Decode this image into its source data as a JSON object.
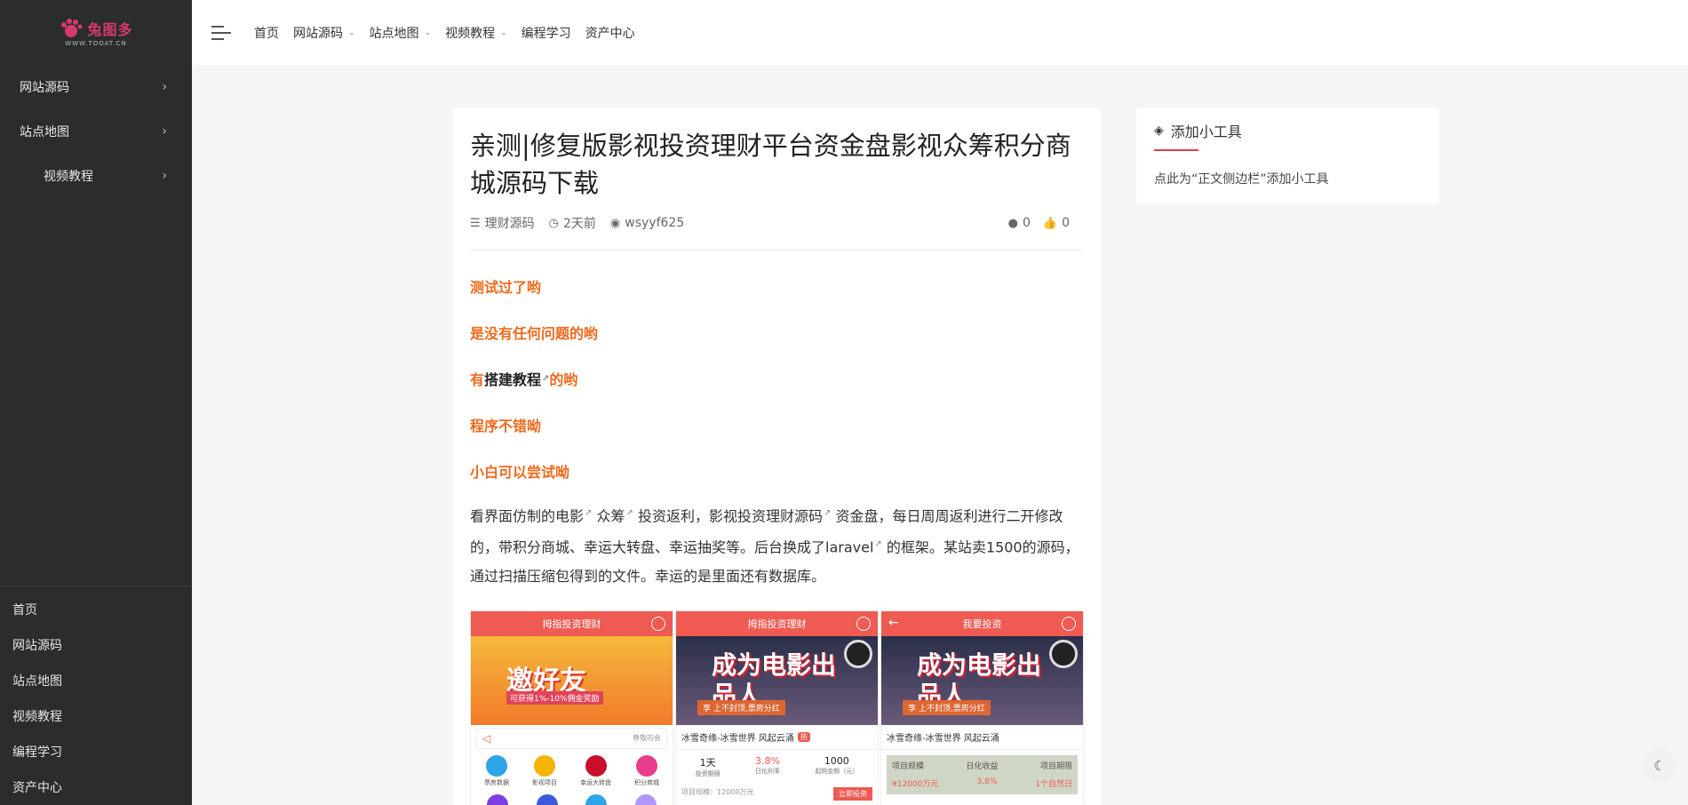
{
  "logo": {
    "text": "兔图多",
    "sub": "WWW.TOOAT.CN"
  },
  "sidebar": {
    "items": [
      {
        "label": "网站源码",
        "indent": false
      },
      {
        "label": "站点地图",
        "indent": false
      },
      {
        "label": "视频教程",
        "indent": true
      }
    ],
    "chevron": "›",
    "bottom_links": [
      "首页",
      "网站源码",
      "站点地图",
      "视频教程",
      "编程学习",
      "资产中心"
    ]
  },
  "topnav": {
    "items": [
      {
        "label": "首页",
        "dropdown": false
      },
      {
        "label": "网站源码",
        "dropdown": true
      },
      {
        "label": "站点地图",
        "dropdown": true
      },
      {
        "label": "视频教程",
        "dropdown": true
      },
      {
        "label": "编程学习",
        "dropdown": false
      },
      {
        "label": "资产中心",
        "dropdown": false
      }
    ],
    "caret": "⌄"
  },
  "post": {
    "title": "亲测|修复版影视投资理财平台资金盘影视众筹积分商城源码下载",
    "meta": {
      "category": "理财源码",
      "time": "2天前",
      "author": "wsyyf625",
      "comments": "0",
      "likes": "0"
    },
    "lines": {
      "l1": "测试过了哟",
      "l2": "是没有任何问题的哟",
      "l3_pre": "有",
      "l3_link": "搭建教程",
      "l3_post": " 的哟",
      "l4": "程序不错呦",
      "l5": "小白可以尝试呦"
    },
    "paragraph": {
      "p1": "看界面仿制的电影",
      "p2": " 众筹",
      "p3": " 投资返利，影视投资理财源码",
      "p4": "  资金盘，每日周周返利进行二开修改的，带积分商城、幸运大转盘、幸运抽奖等。后台换成了laravel",
      "p5": " 的框架。某站卖1500的源码，通过扫描压缩包得到的文件。幸运的是里面还有数据库。"
    },
    "ext_icon": "↗",
    "screens": {
      "s1": {
        "head": "拇指投资理财",
        "banner_big": "邀好友",
        "banner_small": "可获得1%-10%佣金奖励",
        "notice_right": "尊敬的会",
        "icons": [
          "票房数据",
          "影视项目",
          "幸运大转盘",
          "积分商城"
        ]
      },
      "s2": {
        "head": "拇指投资理财",
        "banner_big": "成为电影出品人",
        "ribbon": "享 上不封顶,票房分红",
        "title": "冰雪奇缘-冰雪世界 风起云涌",
        "hot": "热",
        "stats": [
          {
            "value": "1天",
            "label": "投资期限"
          },
          {
            "value": "3.8%",
            "label": "日化利率"
          },
          {
            "value": "1000",
            "label": "起购金额（元）"
          }
        ],
        "row_left": "项目规模：12000万元",
        "row_right": "立即投资"
      },
      "s3": {
        "head": "我要投资",
        "banner_big": "成为电影出品人",
        "ribbon": "享 上不封顶,票房分红",
        "title": "冰雪奇缘-冰雪世界 风起云涌",
        "table_head": [
          "项目规模",
          "日化收益",
          "项目期限"
        ],
        "table_vals": [
          "¥12000万元",
          "3.8%",
          "1个自然日"
        ]
      }
    }
  },
  "widget": {
    "title": "添加小工具",
    "text": "点此为“正文侧边栏”添加小工具"
  },
  "colors": {
    "accent": "#ef6a1c",
    "sidebar_bg": "#2b2c2e",
    "widget_line": "#e03a4b"
  }
}
